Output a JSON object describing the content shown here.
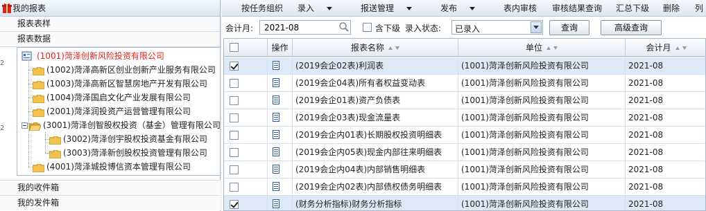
{
  "left": {
    "title": "我的报表",
    "sections": {
      "templates": "报表表样",
      "data": "报表数据",
      "inbox": "我的收件箱",
      "outbox": "我的发件箱"
    },
    "tree": [
      {
        "label": "(1001)菏泽创新风险投资有限公司",
        "selected": true
      },
      {
        "label": "(1002)菏泽高新区创业创新产业服务有限公司"
      },
      {
        "label": "(1003)菏泽高新区智慧房地产开发有限公司"
      },
      {
        "label": "(1004)菏泽国启文化产业发展有限公司"
      },
      {
        "label": "(2001)菏泽润投资产运营管理有限公司"
      },
      {
        "label": "(3001)菏泽创智股权投资（基金）管理有限公司"
      },
      {
        "label": "(3002)菏泽创宇股权投资基金有限公司"
      },
      {
        "label": "(3003)菏泽新创股权投资管理有限公司"
      },
      {
        "label": "(4001)菏泽城投博信资本管理有限公司"
      }
    ]
  },
  "toolbar": {
    "items": [
      "按任务组织",
      "录入",
      "报送管理",
      "发布",
      "表内审核",
      "审核结果查询",
      "汇总下级",
      "删除",
      "列"
    ]
  },
  "filter": {
    "period_label": "会计月:",
    "period_value": "2021-08",
    "include_sub_label": "含下级",
    "status_label": "录入状态:",
    "status_value": "已录入",
    "query_button": "查询",
    "advanced_button": "高级查询"
  },
  "grid": {
    "headers": {
      "op": "操作",
      "name": "报表名称",
      "unit": "单位",
      "period": "会计月"
    },
    "rows": [
      {
        "checked": true,
        "name": "(2019会企02表)利润表",
        "unit": "(1001)菏泽创新风险投资有限公司",
        "period": "2021-08"
      },
      {
        "checked": false,
        "name": "(2019会企04表)所有者权益变动表",
        "unit": "(1001)菏泽创新风险投资有限公司",
        "period": "2021-08"
      },
      {
        "checked": false,
        "name": "(2019会企01表)资产负债表",
        "unit": "(1001)菏泽创新风险投资有限公司",
        "period": "2021-08"
      },
      {
        "checked": false,
        "name": "(2019会企03表)现金流量表",
        "unit": "(1001)菏泽创新风险投资有限公司",
        "period": "2021-08"
      },
      {
        "checked": false,
        "name": "(2019会企内01表)长期股权投资明细表",
        "unit": "(1001)菏泽创新风险投资有限公司",
        "period": "2021-08"
      },
      {
        "checked": false,
        "name": "(2019会企内05表)现金内部往来明细表",
        "unit": "(1001)菏泽创新风险投资有限公司",
        "period": "2021-08"
      },
      {
        "checked": false,
        "name": "(2019会企内04表)内部销售明细表",
        "unit": "(1001)菏泽创新风险投资有限公司",
        "period": "2021-08"
      },
      {
        "checked": false,
        "name": "(2019会企内02表)内部债权债务明细表",
        "unit": "(1001)菏泽创新风险投资有限公司",
        "period": "2021-08"
      },
      {
        "checked": true,
        "name": "(财务分析指标)财务分析指标",
        "unit": "(1001)菏泽创新风险投资有限公司",
        "period": "2021-08"
      }
    ]
  },
  "gutter": [
    "2",
    "2",
    "3"
  ],
  "colors": {
    "selected_row": "#dde9f6",
    "root_text": "#e0231b",
    "folder": "#f2c14e"
  }
}
